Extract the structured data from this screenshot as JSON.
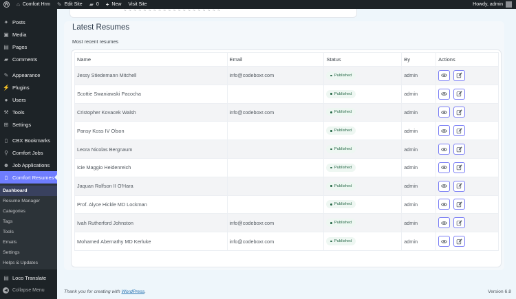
{
  "adminbar": {
    "site_name": "Comfort Hrm",
    "edit_site": "Edit Site",
    "comments_count": "0",
    "new_label": "New",
    "visit_site": "Visit Site",
    "howdy": "Howdy, admin"
  },
  "sidebar": {
    "items": [
      {
        "label": "Posts",
        "icon": "pin-icon"
      },
      {
        "label": "Media",
        "icon": "media-icon"
      },
      {
        "label": "Pages",
        "icon": "pages-icon"
      },
      {
        "label": "Comments",
        "icon": "comments-icon"
      },
      {
        "label": "Appearance",
        "icon": "brush-icon"
      },
      {
        "label": "Plugins",
        "icon": "plugin-icon"
      },
      {
        "label": "Users",
        "icon": "users-icon"
      },
      {
        "label": "Tools",
        "icon": "wrench-icon"
      },
      {
        "label": "Settings",
        "icon": "settings-icon"
      },
      {
        "label": "CBX Bookmarks",
        "icon": "bookmark-icon"
      },
      {
        "label": "Comfort Jobs",
        "icon": "search-icon"
      },
      {
        "label": "Job Applications",
        "icon": "person-icon"
      },
      {
        "label": "Comfort Resumes",
        "icon": "document-icon"
      }
    ],
    "submenu": [
      "Dashboard",
      "Resume Manager",
      "Categories",
      "Tags",
      "Tools",
      "Emails",
      "Settings",
      "Helps & Updates"
    ],
    "loco": "Loco Translate",
    "collapse": "Collapse Menu"
  },
  "panel": {
    "title": "Latest Resumes",
    "subtitle": "Most recent resumes"
  },
  "table": {
    "headers": [
      "Name",
      "Email",
      "Status",
      "By",
      "Actions"
    ],
    "rows": [
      {
        "name": "Jessy Stiedemann Mitchell",
        "email": "info@codeboxr.com",
        "status": "Published",
        "by": "admin"
      },
      {
        "name": "Scottie Swaniawski Pacocha",
        "email": "",
        "status": "Published",
        "by": "admin"
      },
      {
        "name": "Cristopher Kovacek Walsh",
        "email": "info@codeboxr.com",
        "status": "Published",
        "by": "admin"
      },
      {
        "name": "Pansy Koss IV Olson",
        "email": "",
        "status": "Published",
        "by": "admin"
      },
      {
        "name": "Leora Nicolas Bergnaum",
        "email": "",
        "status": "Published",
        "by": "admin"
      },
      {
        "name": "Icie Maggio Heidenreich",
        "email": "",
        "status": "Published",
        "by": "admin"
      },
      {
        "name": "Jaquan Rolfson II O'Hara",
        "email": "",
        "status": "Published",
        "by": "admin"
      },
      {
        "name": "Prof. Alyce Hickle MD Lockman",
        "email": "",
        "status": "Published",
        "by": "admin"
      },
      {
        "name": "Ivah Rutherford Johnston",
        "email": "info@codeboxr.com",
        "status": "Published",
        "by": "admin"
      },
      {
        "name": "Mohamed Abernathy MD Kerluke",
        "email": "info@codeboxr.com",
        "status": "Published",
        "by": "admin"
      }
    ]
  },
  "footer": {
    "thanks_prefix": "Thank you for creating with ",
    "wordpress": "WordPress",
    "thanks_suffix": ".",
    "version": "Version 6.8"
  },
  "colors": {
    "accent": "#6f7dff",
    "sidebar_bg": "#1d2327",
    "badge_text": "#2a6b4a"
  }
}
